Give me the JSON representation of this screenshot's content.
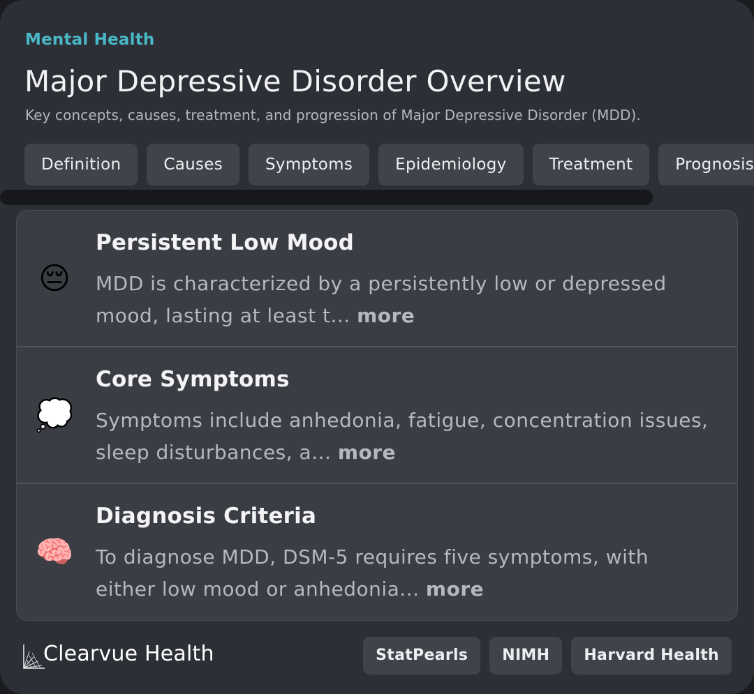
{
  "header": {
    "category": "Mental Health",
    "title": "Major Depressive Disorder Overview",
    "subtitle": "Key concepts, causes, treatment, and progression of Major Depressive Disorder (MDD)."
  },
  "tabs": [
    {
      "label": "Definition"
    },
    {
      "label": "Causes"
    },
    {
      "label": "Symptoms"
    },
    {
      "label": "Epidemiology"
    },
    {
      "label": "Treatment"
    },
    {
      "label": "Prognosis"
    }
  ],
  "items": [
    {
      "icon": "😔",
      "icon_name": "pensive-face-icon",
      "title": "Persistent Low Mood",
      "body": "MDD is characterized by a persistently low or depressed mood, lasting at least t...",
      "more": "more"
    },
    {
      "icon": "💭",
      "icon_name": "thought-bubble-icon",
      "title": "Core Symptoms",
      "body": "Symptoms include anhedonia, fatigue, concentration issues, sleep disturbances, a...",
      "more": "more"
    },
    {
      "icon": "🧠",
      "icon_name": "brain-icon",
      "title": "Diagnosis Criteria",
      "body": "To diagnose MDD, DSM-5 requires five symptoms, with either low mood or anhedonia...",
      "more": "more"
    }
  ],
  "footer": {
    "brand": "Clearvue Health",
    "sources": [
      {
        "label": "StatPearls"
      },
      {
        "label": "NIMH"
      },
      {
        "label": "Harvard Health"
      }
    ]
  },
  "colors": {
    "background": "#2d2f37",
    "accent": "#4ab8c6",
    "chip": "#41434b",
    "list_background": "#3b3d45"
  }
}
